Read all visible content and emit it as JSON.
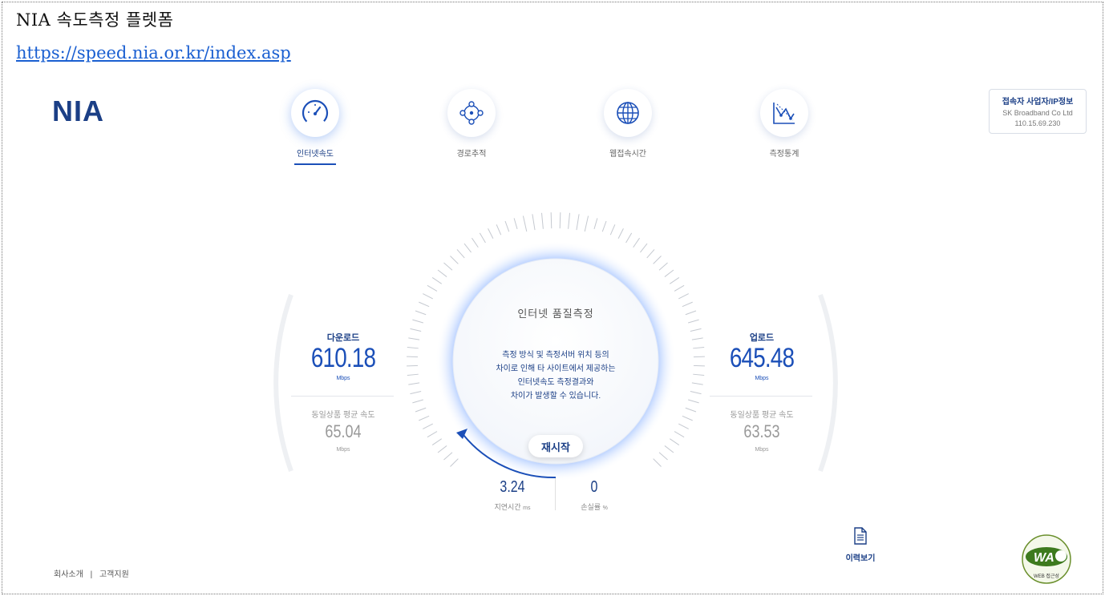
{
  "document": {
    "title": "NIA 속도측정 플렛폼",
    "url": "https://speed.nia.or.kr/index.asp"
  },
  "header": {
    "logo": "NIA",
    "nav": [
      {
        "label": "인터넷속도",
        "icon": "speedometer-icon",
        "active": true
      },
      {
        "label": "경로추적",
        "icon": "route-trace-icon",
        "active": false
      },
      {
        "label": "웹접속시간",
        "icon": "globe-icon",
        "active": false
      },
      {
        "label": "측정통계",
        "icon": "statistics-icon",
        "active": false
      }
    ],
    "isp": {
      "title": "접속자 사업자/IP정보",
      "provider": "SK Broadband Co Ltd",
      "ip": "110.15.69.230"
    }
  },
  "measurement": {
    "download": {
      "title": "다운로드",
      "value": "610.18",
      "unit": "Mbps",
      "avg_label": "동일상품 평균 속도",
      "avg_value": "65.04",
      "avg_unit": "Mbps"
    },
    "upload": {
      "title": "업로드",
      "value": "645.48",
      "unit": "Mbps",
      "avg_label": "동일상품 평균 속도",
      "avg_value": "63.53",
      "avg_unit": "Mbps"
    },
    "center": {
      "title": "인터넷 품질측정",
      "message_lines": [
        "측정 방식 및 측정서버 위치 등의",
        "차이로 인해 타 사이트에서 제공하는",
        "인터넷속도 측정결과와",
        "차이가 발생할 수 있습니다."
      ],
      "restart_label": "재시작"
    },
    "latency": {
      "value": "3.24",
      "label": "지연시간",
      "unit": "ms"
    },
    "loss": {
      "value": "0",
      "label": "손실률",
      "unit": "%"
    }
  },
  "history": {
    "label": "이력보기",
    "icon": "document-icon"
  },
  "footer": {
    "about": "회사소개",
    "separator": "|",
    "support": "고객지원"
  },
  "badge": {
    "name": "wa-web-accessibility-badge",
    "text": "WA",
    "caption": "WEB 접근성"
  },
  "colors": {
    "primary": "#1b3f86",
    "accent": "#1b4fb8",
    "link": "#1a5fd1",
    "muted": "#999999"
  }
}
